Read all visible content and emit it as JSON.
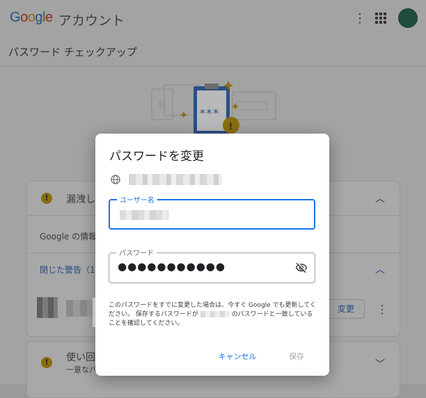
{
  "app": {
    "logo_text": "Google",
    "logo_suffix": "アカウント",
    "page_title": "パスワード チェックアップ"
  },
  "background": {
    "card1": {
      "section_title": "漏洩した",
      "info_text": "Google の情報に",
      "closed_warnings": "閉じた警告（1 件",
      "change_button": "変更"
    },
    "card2": {
      "title": "使い回",
      "subtitle": "一意なパ"
    },
    "kebab": "⋮"
  },
  "dialog": {
    "title": "パスワードを変更",
    "username_label": "ユーザー名",
    "password_label": "パスワード",
    "password_value": "●●●●●●●●●●●",
    "note_part1": "このパスワードをすでに変更した場合は、今すぐ Google でも更新してください。 保存するパスワードが",
    "note_part2": "のパスワードと一致していることを確認してください。",
    "cancel_label": "キャンセル",
    "save_label": "保存"
  },
  "colors": {
    "accent": "#1a73e8",
    "warning": "#f9ab00",
    "disabled_text": "#a8aaad"
  },
  "icons": {
    "globe": "globe-icon",
    "visibility_off": "visibility-off-icon",
    "warning": "warning-icon",
    "apps": "apps-grid-icon",
    "more": "more-vert-icon"
  }
}
